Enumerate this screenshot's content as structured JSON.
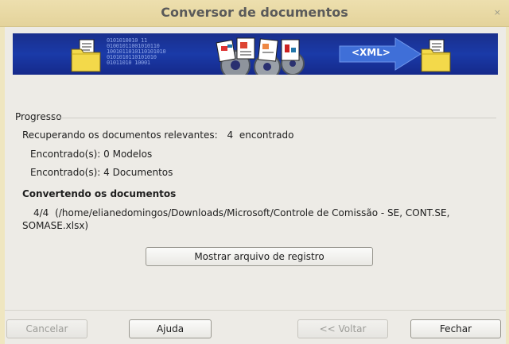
{
  "window": {
    "title": "Conversor de documentos",
    "close_glyph": "×"
  },
  "banner": {
    "xml_label": "<XML>",
    "bits_lines": [
      "0101010010 11",
      "01001011001010110",
      "1001011010110101010",
      "0101010110101010",
      "01011010 10001"
    ]
  },
  "progress": {
    "section_label": "Progresso",
    "retrieving_label": "Recuperando os documentos relevantes:",
    "retrieving_count": "4",
    "retrieving_suffix": "encontrado",
    "found_models": "Encontrado(s): 0 Modelos",
    "found_documents": "Encontrado(s): 4 Documentos",
    "converting_heading": "Convertendo os documentos",
    "converting_counter": "4/4",
    "converting_path_line1": "(/home/elianedomingos/Downloads/Microsoft/Controle de Comissão - SE, CONT.SE,",
    "converting_path_line2": "SOMASE.xlsx)"
  },
  "buttons": {
    "show_log": "Mostrar arquivo de registro",
    "cancel": "Cancelar",
    "help": "Ajuda",
    "back": "<< Voltar",
    "close": "Fechar"
  },
  "colors": {
    "banner_blue": "#1a3aa8",
    "title_bar": "#e9dba6",
    "dialog_bg": "#edebe6"
  }
}
